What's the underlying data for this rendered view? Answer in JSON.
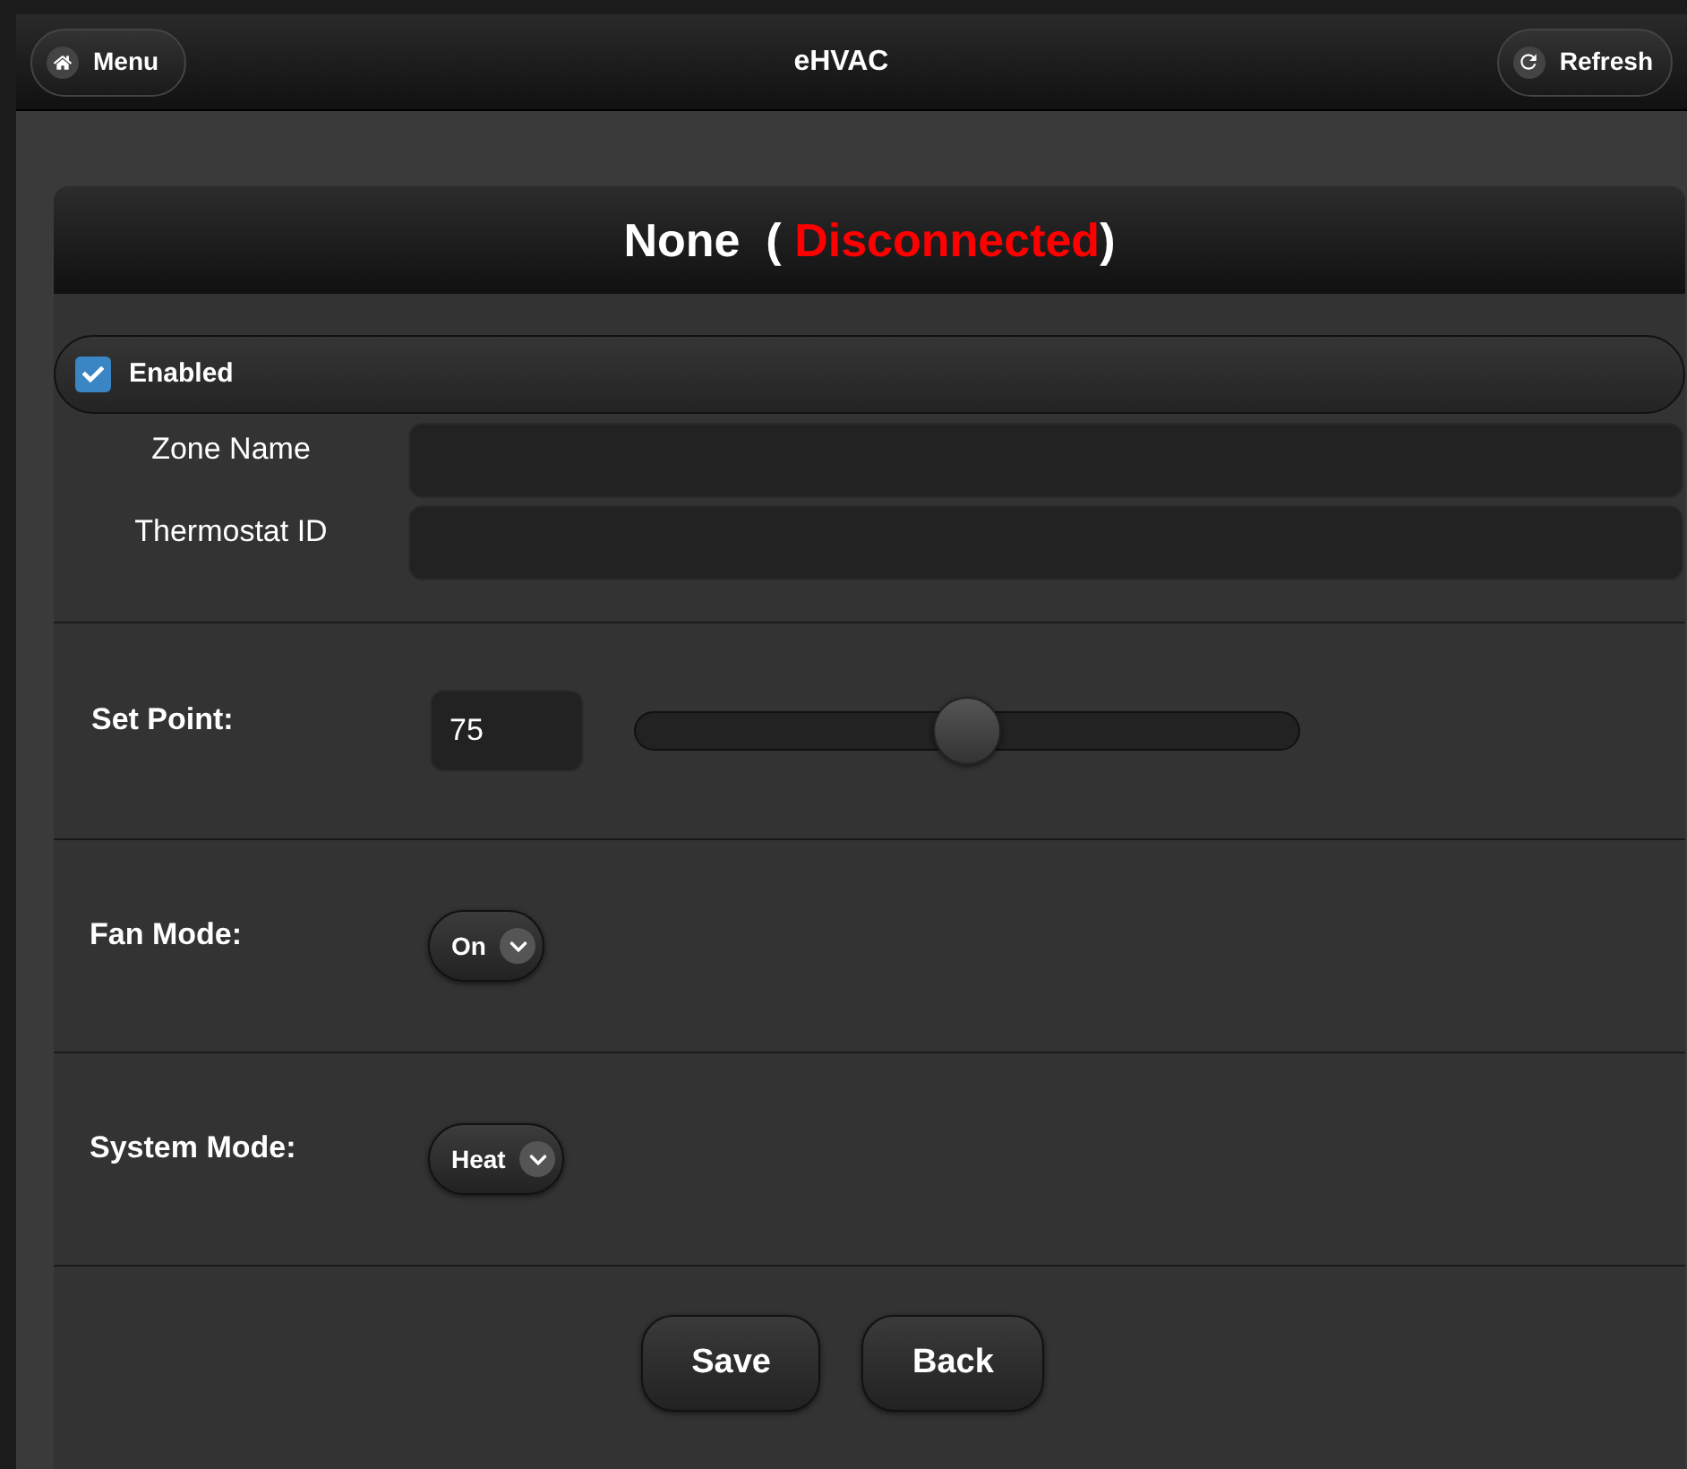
{
  "header": {
    "menu_button": "Menu",
    "title": "eHVAC",
    "refresh_button": "Refresh"
  },
  "zone": {
    "name": "None",
    "open_paren": "(",
    "status": "Disconnected",
    "close_paren": ")",
    "connected": false
  },
  "enabled": {
    "label": "Enabled",
    "checked": true
  },
  "fields": [
    {
      "label": "Zone Name"
    },
    {
      "label": "Thermostat ID"
    }
  ],
  "set_point": {
    "label": "Set Point:",
    "value": "75",
    "level": 0.5
  },
  "fan_mode": {
    "label": "Fan Mode:",
    "value": "On"
  },
  "system_mode": {
    "label": "System Mode:",
    "value": "Heat"
  },
  "buttons": [
    "Save",
    "Back"
  ]
}
